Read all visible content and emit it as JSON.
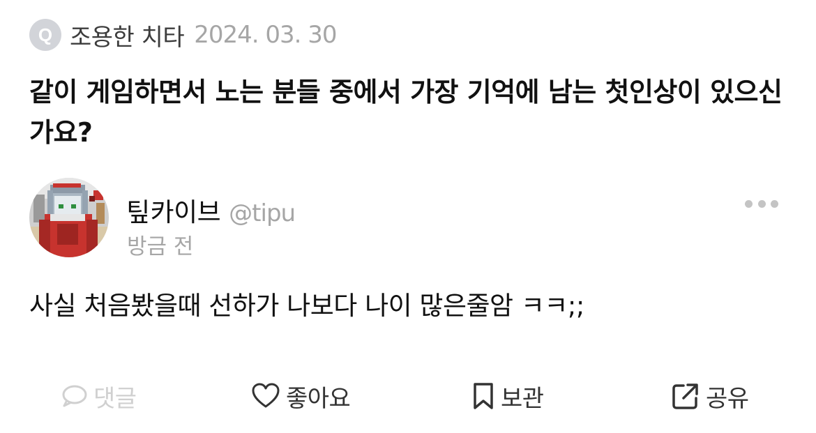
{
  "question": {
    "badge": "Q",
    "asker": "조용한 치타",
    "date": "2024. 03. 30",
    "text": "같이 게임하면서 노는 분들 중에서 가장 기억에 남는 첫인상이 있으신가요?"
  },
  "answer": {
    "avatar": "minecraft-skin-avatar",
    "name": "팊카이브",
    "handle": "@tipu",
    "time": "방금 전",
    "more_icon": "more-dots-icon",
    "body": "사실 처음봤을때 선하가 나보다 나이 많은줄암 ㅋㅋ;;"
  },
  "actions": {
    "comment": {
      "label": "댓글",
      "icon": "comment-bubble-icon",
      "enabled": false
    },
    "like": {
      "label": "좋아요",
      "icon": "heart-icon",
      "enabled": true
    },
    "save": {
      "label": "보관",
      "icon": "bookmark-icon",
      "enabled": true
    },
    "share": {
      "label": "공유",
      "icon": "share-icon",
      "enabled": true
    }
  },
  "colors": {
    "text": "#111111",
    "muted": "#a6a6a6",
    "badge_bg": "#d2d4d9",
    "disabled": "#d0d0d0",
    "icon": "#333333"
  }
}
